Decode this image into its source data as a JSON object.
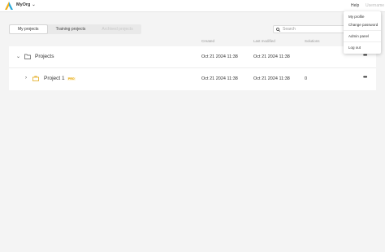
{
  "topbar": {
    "org_name": "MyOrg",
    "help_label": "Help",
    "user_label": "Username"
  },
  "tabs": [
    {
      "label": "My projects",
      "state": "active"
    },
    {
      "label": "Training projects",
      "state": "normal"
    },
    {
      "label": "Archived projects",
      "state": "disabled"
    }
  ],
  "search": {
    "placeholder": "Search"
  },
  "columns": {
    "created": "Created",
    "modified": "Last modified",
    "solutions": "Solutions"
  },
  "rows": [
    {
      "name": "Projects",
      "icon": "folder-icon",
      "created": "Oct 21 2024 11:38",
      "modified": "Oct 21 2024 11:38",
      "solutions": ""
    },
    {
      "name": "Project 1",
      "icon": "briefcase-icon",
      "badge": "PRO",
      "created": "Oct 21 2024 11:38",
      "modified": "Oct 21 2024 11:38",
      "solutions": "0"
    }
  ],
  "menu": {
    "items": [
      "My profile",
      "Change password",
      "Admin panel",
      "Log out"
    ]
  },
  "colors": {
    "accent": "#e0a000",
    "background": "#f4f4f4"
  }
}
